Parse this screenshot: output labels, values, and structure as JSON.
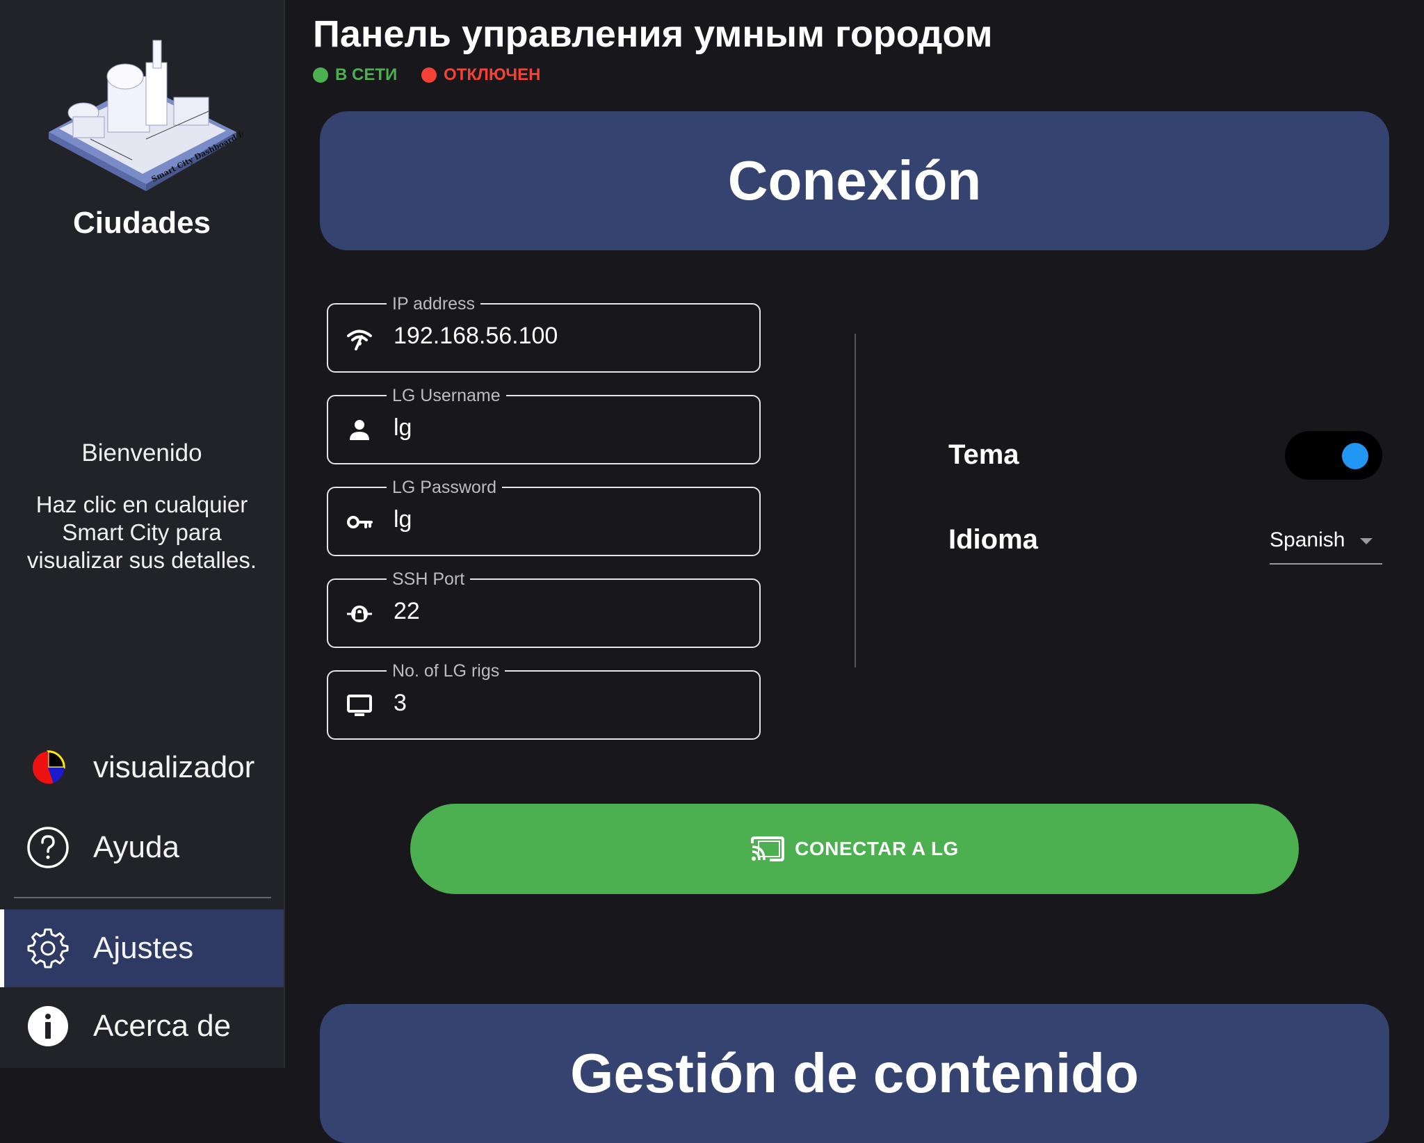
{
  "header": {
    "title": "Панель управления умным городом",
    "status_online": "В СЕТИ",
    "status_offline": "ОТКЛЮЧЕН",
    "online_color": "#4caf50",
    "offline_color": "#f44336"
  },
  "sidebar": {
    "title": "Ciudades",
    "logo_text": "Smart City Dashboard for",
    "welcome": "Bienvenido",
    "description": "Haz clic en cualquier Smart City para visualizar sus detalles.",
    "nav": [
      {
        "label": "visualizador",
        "icon": "pie-chart-icon",
        "active": false
      },
      {
        "label": "Ayuda",
        "icon": "help-icon",
        "active": false
      },
      {
        "label": "Ajustes",
        "icon": "gear-icon",
        "active": true
      },
      {
        "label": "Acerca de",
        "icon": "info-icon",
        "active": false
      }
    ]
  },
  "connection": {
    "title": "Conexión",
    "fields": [
      {
        "label": "IP address",
        "value": "192.168.56.100",
        "icon": "wifi-icon"
      },
      {
        "label": "LG Username",
        "value": "lg",
        "icon": "person-icon"
      },
      {
        "label": "LG Password",
        "value": "lg",
        "icon": "key-icon"
      },
      {
        "label": "SSH Port",
        "value": "22",
        "icon": "lock-icon"
      },
      {
        "label": "No. of LG rigs",
        "value": "3",
        "icon": "monitor-icon"
      }
    ],
    "connect_button": "CONECTAR A LG"
  },
  "settings": {
    "theme_label": "Tema",
    "theme_dark": true,
    "language_label": "Idioma",
    "language_value": "Spanish"
  },
  "content": {
    "title": "Gestión de contenido"
  },
  "colors": {
    "accent": "#354371",
    "toggle_knob": "#2196f3",
    "connect_button": "#4caf50"
  }
}
